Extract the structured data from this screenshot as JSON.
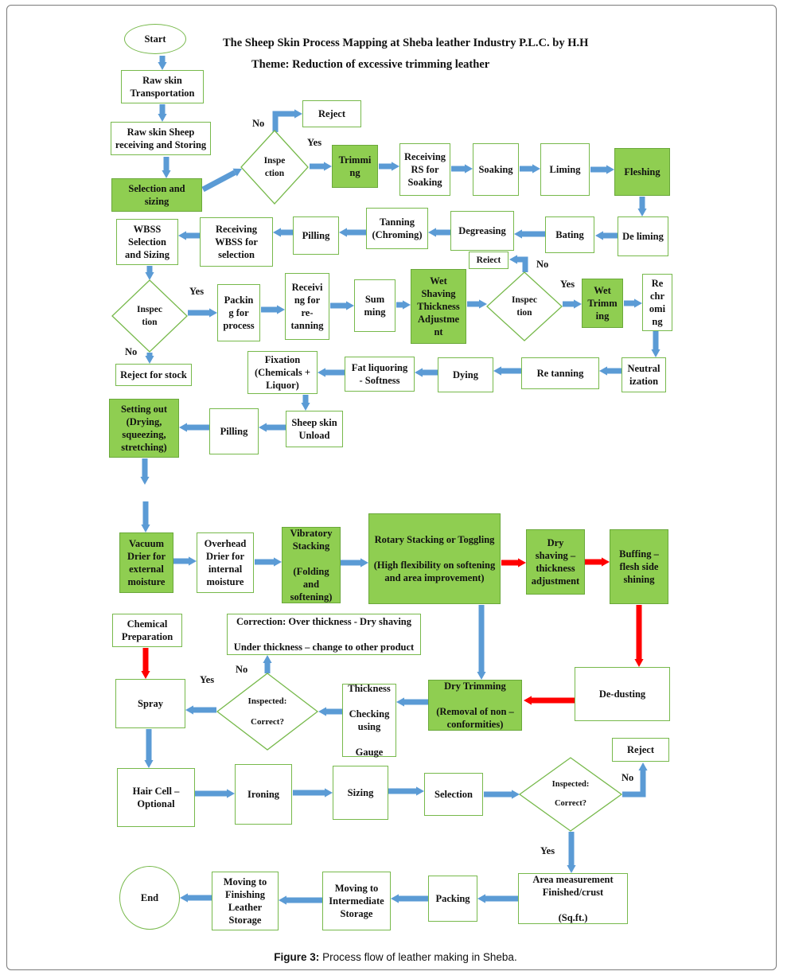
{
  "title": "The Sheep Skin Process Mapping at Sheba leather Industry P.L.C. by H.H",
  "theme": "Theme: Reduction of excessive trimming leather",
  "caption": {
    "label": "Figure 3:",
    "text": " Process flow of leather making in Sheba."
  },
  "colors": {
    "box_border": "#77b94b",
    "highlight_fill": "#8fce51",
    "flow_arrow": "#5b9bd5",
    "critical_arrow": "#ff0000"
  },
  "terminals": {
    "start": "Start",
    "end": "End"
  },
  "steps": {
    "raw_transport": "Raw skin\nTransportation",
    "raw_receiving": "Raw skin Sheep\nreceiving and Storing",
    "selection_sizing": "Selection and\nsizing",
    "reject_1": "Reject",
    "trimming": "Trimmi\nng",
    "receiving_rs": "Receiving\nRS for\nSoaking",
    "soaking": "Soaking",
    "liming": "Liming",
    "fleshing": "Fleshing",
    "deliming": "De liming",
    "bating": "Bating",
    "degreasing": "Degreasing",
    "tanning": "Tanning\n(Chroming)",
    "pilling_1": "Pilling",
    "receiving_wbss": "Receiving\nWBSS for\nselection",
    "wbss_selection": "WBSS\nSelection\nand Sizing",
    "reject_stock": "Reject for stock",
    "packing_process": "Packin\ng for\nprocess",
    "receiving_retan": "Receivi\nng for\nre-\ntanning",
    "summing": "Sum\nming",
    "wet_shaving": "Wet\nShaving\nThickness\nAdjustme\nnt",
    "reject_2": "Reiect",
    "wet_trimming": "Wet\nTrimm\ning",
    "rechroming": "Re\nchr\nomi\nng",
    "neutralization": "Neutral\nization",
    "retanning": "Re tanning",
    "dying": "Dying",
    "fat_liquoring": "Fat liquoring\n- Softness",
    "fixation": "Fixation\n(Chemicals +\nLiquor)",
    "unload": "Sheep skin\nUnload",
    "pilling_2": "Pilling",
    "setting_out": "Setting out\n(Drying,\nsqueezing,\nstretching)",
    "vacuum_drier": "Vacuum\nDrier for\nexternal\nmoisture",
    "overhead_drier": "Overhead\nDrier for\ninternal\nmoisture",
    "vibratory": "Vibratory\nStacking\n\n(Folding\nand\nsoftening)",
    "rotary": "Rotary Stacking or Toggling\n\n(High flexibility on softening\nand area improvement)",
    "dry_shaving": "Dry\nshaving –\nthickness\nadjustment",
    "buffing": "Buffing –\nflesh side\nshining",
    "dedusting": "De-dusting",
    "dry_trimming": "Dry Trimming\n\n(Removal of non –\nconformities)",
    "thickness_check": "Thickness\n\nChecking\nusing\n\nGauge",
    "correction": "Correction: Over thickness - Dry shaving\n\nUnder thickness – change to other product",
    "chemical_prep": "Chemical\nPreparation",
    "spray": "Spray",
    "hair_cell": "Hair Cell –\nOptional",
    "ironing": "Ironing",
    "sizing": "Sizing",
    "selection": "Selection",
    "reject_3": "Reject",
    "area_measurement": "Area measurement\nFinished/crust\n\n(Sq.ft.)",
    "packing": "Packing",
    "intermediate_storage": "Moving to\nIntermediate\nStorage",
    "finishing_storage": "Moving to\nFinishing\nLeather\nStorage"
  },
  "decisions": {
    "inspection_1": "Inspe\nction",
    "inspection_2": "Inspec\ntion",
    "inspection_3": "Inspec\ntion",
    "inspected_thickness": "Inspected:\n\nCorrect?",
    "inspected_final": "Inspected:\n\nCorrect?"
  },
  "branch_labels": {
    "no": "No",
    "yes": "Yes"
  }
}
